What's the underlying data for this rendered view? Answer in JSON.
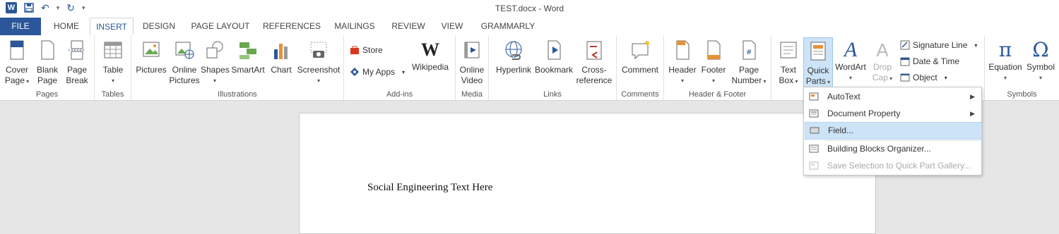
{
  "window": {
    "title": "TEST.docx - Word"
  },
  "qat": {
    "undo_icon": "undo-icon",
    "redo_icon": "redo-icon",
    "save_icon": "save-icon"
  },
  "tabs": [
    "FILE",
    "HOME",
    "INSERT",
    "DESIGN",
    "PAGE LAYOUT",
    "REFERENCES",
    "MAILINGS",
    "REVIEW",
    "VIEW",
    "GRAMMARLY"
  ],
  "active_tab": "INSERT",
  "ribbon": {
    "groups": {
      "pages": "Pages",
      "tables": "Tables",
      "illustrations": "Illustrations",
      "addins": "Add-ins",
      "media": "Media",
      "links": "Links",
      "comments": "Comments",
      "header_footer": "Header & Footer",
      "symbols": "Symbols"
    },
    "buttons": {
      "cover_page": [
        "Cover",
        "Page"
      ],
      "blank_page": [
        "Blank",
        "Page"
      ],
      "page_break": [
        "Page",
        "Break"
      ],
      "table": "Table",
      "pictures": "Pictures",
      "online_pictures": [
        "Online",
        "Pictures"
      ],
      "shapes": "Shapes",
      "smartart": "SmartArt",
      "chart": "Chart",
      "screenshot": "Screenshot",
      "store": "Store",
      "my_apps": "My Apps",
      "wikipedia": "Wikipedia",
      "online_video": [
        "Online",
        "Video"
      ],
      "hyperlink": "Hyperlink",
      "bookmark": "Bookmark",
      "cross_reference": [
        "Cross-",
        "reference"
      ],
      "comment": "Comment",
      "header": "Header",
      "footer": "Footer",
      "page_number": [
        "Page",
        "Number"
      ],
      "text_box": [
        "Text",
        "Box"
      ],
      "quick_parts": [
        "Quick",
        "Parts"
      ],
      "wordart": "WordArt",
      "drop_cap": [
        "Drop",
        "Cap"
      ],
      "signature_line": "Signature Line",
      "date_time": "Date & Time",
      "object": "Object",
      "equation": "Equation",
      "symbol": "Symbol"
    }
  },
  "document": {
    "text": "Social Engineering Text Here"
  },
  "quick_parts_menu": {
    "items": [
      {
        "label": "AutoText",
        "submenu": true,
        "state": "normal"
      },
      {
        "label": "Document Property",
        "submenu": true,
        "state": "normal"
      },
      {
        "label": "Field...",
        "submenu": false,
        "state": "hover"
      },
      {
        "label": "Building Blocks Organizer...",
        "submenu": false,
        "state": "normal"
      },
      {
        "label": "Save Selection to Quick Part Gallery...",
        "submenu": false,
        "state": "disabled"
      }
    ]
  },
  "colors": {
    "accent": "#2b579a",
    "hover": "#cde3f7",
    "ribbon_bg": "#ffffff",
    "doc_bg": "#e6e6e6"
  }
}
